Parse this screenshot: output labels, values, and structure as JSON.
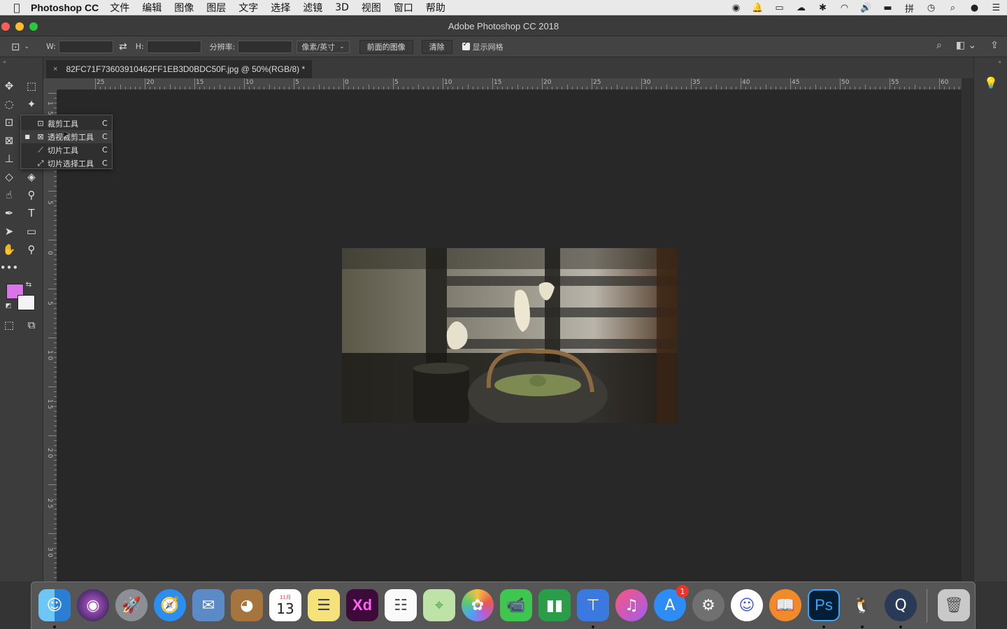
{
  "menubar": {
    "app_name": "Photoshop CC",
    "items": [
      "文件",
      "编辑",
      "图像",
      "图层",
      "文字",
      "选择",
      "滤镜",
      "3D",
      "视图",
      "窗口",
      "帮助"
    ],
    "status_icons": [
      "record-icon",
      "bell-icon",
      "screen-icon",
      "cloud-icon",
      "bluetooth-icon",
      "wifi-icon",
      "volume-icon",
      "battery-icon",
      "input-method-icon",
      "clock-icon",
      "spotlight-icon",
      "siri-icon",
      "list-icon"
    ]
  },
  "window": {
    "title": "Adobe Photoshop CC 2018"
  },
  "options": {
    "w_label": "W:",
    "h_label": "H:",
    "resolution_label": "分辨率:",
    "unit_select": "像素/英寸",
    "front_image_button": "前面的图像",
    "clear_button": "清除",
    "show_grid_label": "显示网格",
    "show_grid_checked": true
  },
  "document": {
    "tab_title": "82FC71F73603910462FF1EB3D0BDC50F.jpg @ 50%(RGB/8) *"
  },
  "ruler": {
    "top_labels": [
      "25",
      "20",
      "15",
      "10",
      "5",
      "0",
      "5",
      "10",
      "15",
      "20",
      "25",
      "30",
      "35",
      "40",
      "45",
      "50",
      "55",
      "60"
    ],
    "left_labels": [
      "1",
      "5",
      "5",
      "0",
      "5",
      "1 0",
      "1 5",
      "2 0",
      "2 5",
      "3 0"
    ]
  },
  "colors": {
    "foreground": "#d975e9",
    "background": "#f3f3f3"
  },
  "flyout": {
    "items": [
      {
        "label": "裁剪工具",
        "shortcut": "C",
        "icon": "crop-icon",
        "active": false
      },
      {
        "label": "透视裁剪工具",
        "shortcut": "C",
        "icon": "perspective-crop-icon",
        "active": true
      },
      {
        "label": "切片工具",
        "shortcut": "C",
        "icon": "slice-icon",
        "active": false
      },
      {
        "label": "切片选择工具",
        "shortcut": "C",
        "icon": "slice-select-icon",
        "active": false
      }
    ]
  },
  "dock": {
    "apps": [
      {
        "name": "Finder",
        "icon": "finder-icon",
        "running": true
      },
      {
        "name": "Siri",
        "icon": "siri-icon",
        "running": false
      },
      {
        "name": "Launchpad",
        "icon": "rocket-icon",
        "running": false
      },
      {
        "name": "Safari",
        "icon": "compass-icon",
        "running": false
      },
      {
        "name": "Mail",
        "icon": "eagle-icon",
        "running": false
      },
      {
        "name": "Contacts",
        "icon": "contacts-icon",
        "running": false
      },
      {
        "name": "Calendar",
        "icon": "calendar-icon",
        "running": false,
        "month": "11月",
        "day": "13"
      },
      {
        "name": "Notes",
        "icon": "notes-icon",
        "running": false
      },
      {
        "name": "Adobe XD",
        "icon": "xd-icon",
        "label": "Xd",
        "running": false
      },
      {
        "name": "Reminders",
        "icon": "reminders-icon",
        "running": false
      },
      {
        "name": "Maps",
        "icon": "maps-icon",
        "running": false
      },
      {
        "name": "Photos",
        "icon": "photos-icon",
        "running": false
      },
      {
        "name": "FaceTime",
        "icon": "facetime-icon",
        "running": false
      },
      {
        "name": "Numbers",
        "icon": "numbers-icon",
        "running": false
      },
      {
        "name": "Keynote",
        "icon": "keynote-icon",
        "running": true
      },
      {
        "name": "iTunes",
        "icon": "music-icon",
        "running": false
      },
      {
        "name": "App Store",
        "icon": "appstore-icon",
        "running": false,
        "badge": "1"
      },
      {
        "name": "System Preferences",
        "icon": "gear-icon",
        "running": false
      },
      {
        "name": "Bear",
        "icon": "smile-icon",
        "running": false
      },
      {
        "name": "iBooks",
        "icon": "book-icon",
        "running": false
      },
      {
        "name": "Photoshop",
        "icon": "ps-icon",
        "label": "Ps",
        "running": true
      },
      {
        "name": "QQ",
        "icon": "penguin-icon",
        "running": true
      },
      {
        "name": "QuickTime",
        "icon": "quicktime-icon",
        "running": true
      },
      {
        "name": "Trash",
        "icon": "trash-icon",
        "running": false
      }
    ]
  }
}
